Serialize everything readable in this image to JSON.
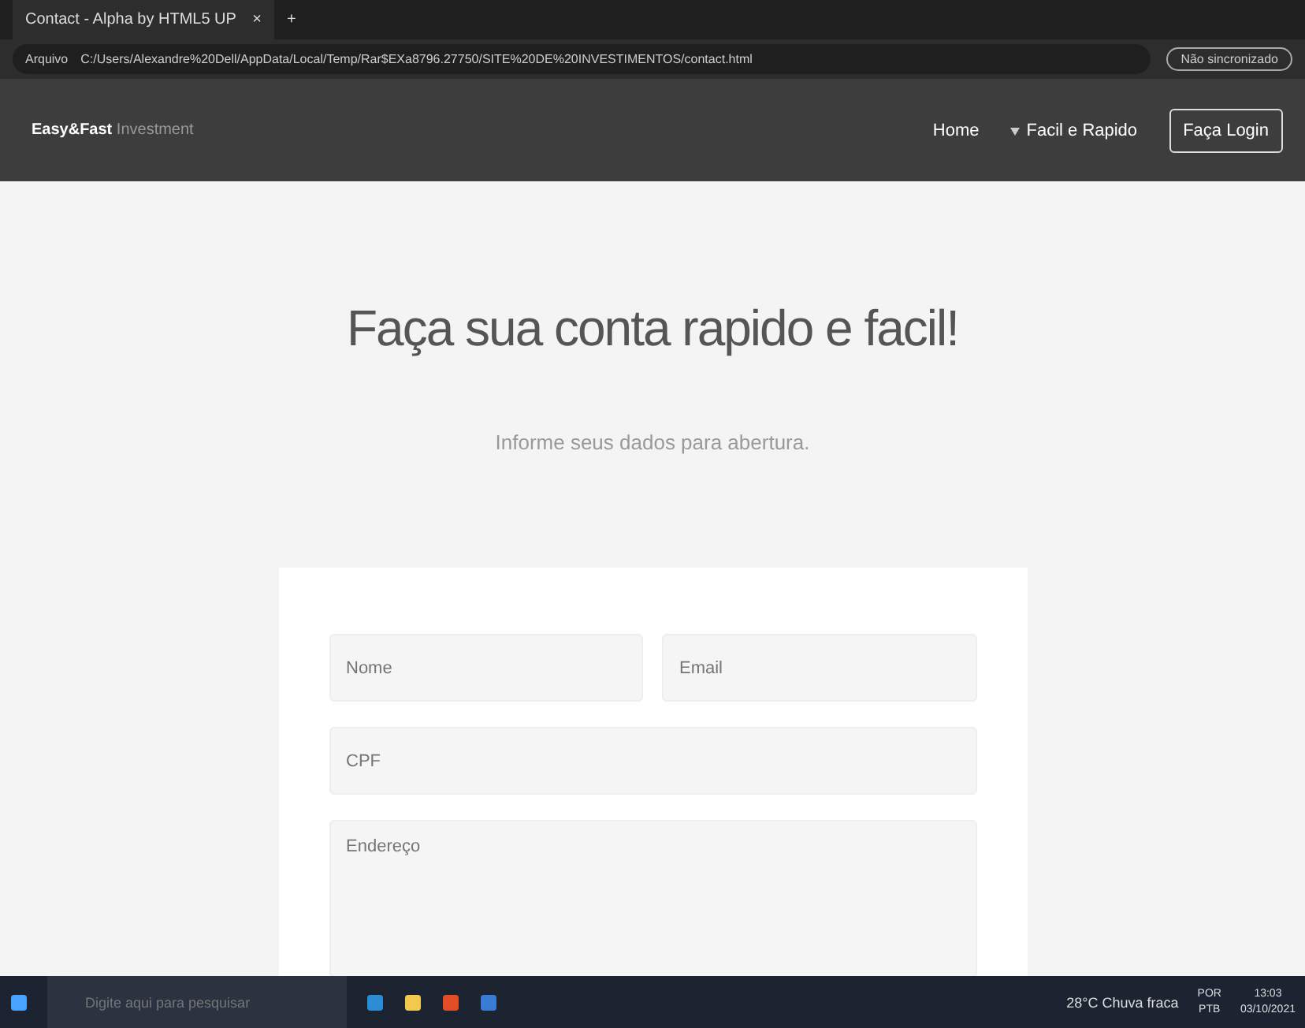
{
  "browser": {
    "tab_title": "Contact - Alpha by HTML5 UP",
    "tab_close": "×",
    "new_tab": "+",
    "site_label": "Arquivo",
    "address": "C:/Users/Alexandre%20Dell/AppData/Local/Temp/Rar$EXa8796.27750/SITE%20DE%20INVESTIMENTOS/contact.html",
    "profile": "Não sincronizado"
  },
  "site": {
    "brand": "Easy&Fast",
    "brand_sub": "Investment",
    "nav": [
      {
        "label": "Home",
        "kind": "link"
      },
      {
        "label": "Facil e Rapido",
        "kind": "dropdown"
      },
      {
        "label": "Faça Login",
        "kind": "button"
      }
    ]
  },
  "hero": {
    "title": "Faça sua conta rapido e facil!",
    "subtitle": "Informe seus dados para abertura."
  },
  "form": {
    "fields": [
      {
        "placeholder": "Nome",
        "kind": "half"
      },
      {
        "placeholder": "Email",
        "kind": "half"
      },
      {
        "placeholder": "CPF",
        "kind": "full"
      },
      {
        "placeholder": "Endereço",
        "kind": "area"
      }
    ]
  },
  "taskbar": {
    "search_placeholder": "Digite aqui para pesquisar",
    "weather": "28°C Chuva fraca",
    "lang_top": "POR",
    "lang_bottom": "PTB",
    "time": "13:03",
    "date": "03/10/2021"
  }
}
